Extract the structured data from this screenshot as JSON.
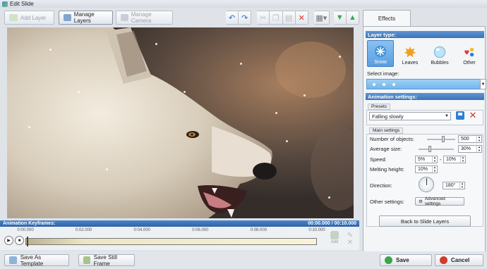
{
  "window": {
    "title": "Edit Slide"
  },
  "toolbar": {
    "add_layer": "Add Layer",
    "manage_layers": "Manage Layers",
    "manage_camera": "Manage Camera"
  },
  "timeline": {
    "header": "Animation Keyframes:",
    "time_display": "00:00.000 / 00:10.000",
    "ticks": [
      "0:00.000",
      "0:02.000",
      "0:04.000",
      "0:06.000",
      "0:08.000",
      "0:10.000"
    ],
    "add_label": "Add"
  },
  "panel": {
    "tab": "Effects",
    "layer_type_header": "Layer type:",
    "layer_types": [
      {
        "label": "Snow",
        "icon": "snowflake-icon"
      },
      {
        "label": "Leaves",
        "icon": "leaf-icon"
      },
      {
        "label": "Bubbles",
        "icon": "bubble-icon"
      },
      {
        "label": "Other",
        "icon": "hearts-icon"
      }
    ],
    "selected_layer_type": "Snow",
    "select_image_label": "Select image:",
    "animation_header": "Animation settings:",
    "presets_tab": "Presets",
    "preset_value": "Falling slowly",
    "main_settings_tab": "Main settings",
    "number_of_objects_label": "Number of objects:",
    "number_of_objects_value": "500",
    "number_of_objects_level": 0.55,
    "average_size_label": "Average size:",
    "average_size_value": "30%",
    "average_size_level": 0.3,
    "speed_label": "Speed:",
    "speed_from": "5%",
    "speed_sep": "-",
    "speed_to": "10%",
    "melting_height_label": "Melting height:",
    "melting_height_value": "10%",
    "direction_label": "Direction:",
    "direction_value": "180°",
    "other_settings_label": "Other settings:",
    "advanced_settings": "Advanced settings",
    "back_button": "Back to Slide Layers"
  },
  "footer": {
    "save_template": "Save As Template",
    "save_still_frame": "Save Still Frame",
    "save": "Save",
    "cancel": "Cancel"
  },
  "colors": {
    "accent_blue": "#3b73b8",
    "header_blue": "#2f63a8",
    "selected_blue": "#5a9ee0",
    "save_green": "#3aa64a",
    "cancel_red": "#d23a2a"
  }
}
